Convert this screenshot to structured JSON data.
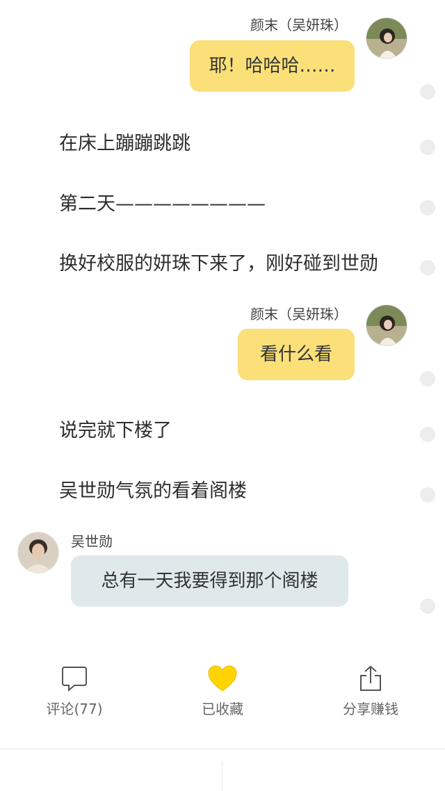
{
  "messages": {
    "m1": {
      "speaker": "颜末（吴妍珠）",
      "text": "耶！哈哈哈……"
    },
    "n1": {
      "text": "在床上蹦蹦跳跳"
    },
    "n2": {
      "text": "第二天————————"
    },
    "n3": {
      "text": "换好校服的妍珠下来了，刚好碰到世勋"
    },
    "m2": {
      "speaker": "颜末（吴妍珠）",
      "text": "看什么看"
    },
    "n4": {
      "text": "说完就下楼了"
    },
    "n5": {
      "text": "吴世勋气氛的看着阁楼"
    },
    "m3": {
      "speaker": "吴世勋",
      "text": "总有一天我要得到那个阁楼"
    }
  },
  "actions": {
    "comment": {
      "label": "评论(77)",
      "icon": "comment-icon"
    },
    "favorite": {
      "label": "已收藏",
      "icon": "heart-icon",
      "color": "#ffd400"
    },
    "share": {
      "label": "分享赚钱",
      "icon": "share-icon"
    }
  },
  "colors": {
    "bubble_right": "#fbe07a",
    "bubble_left": "#dfe9ec",
    "background": "#ffffff"
  }
}
